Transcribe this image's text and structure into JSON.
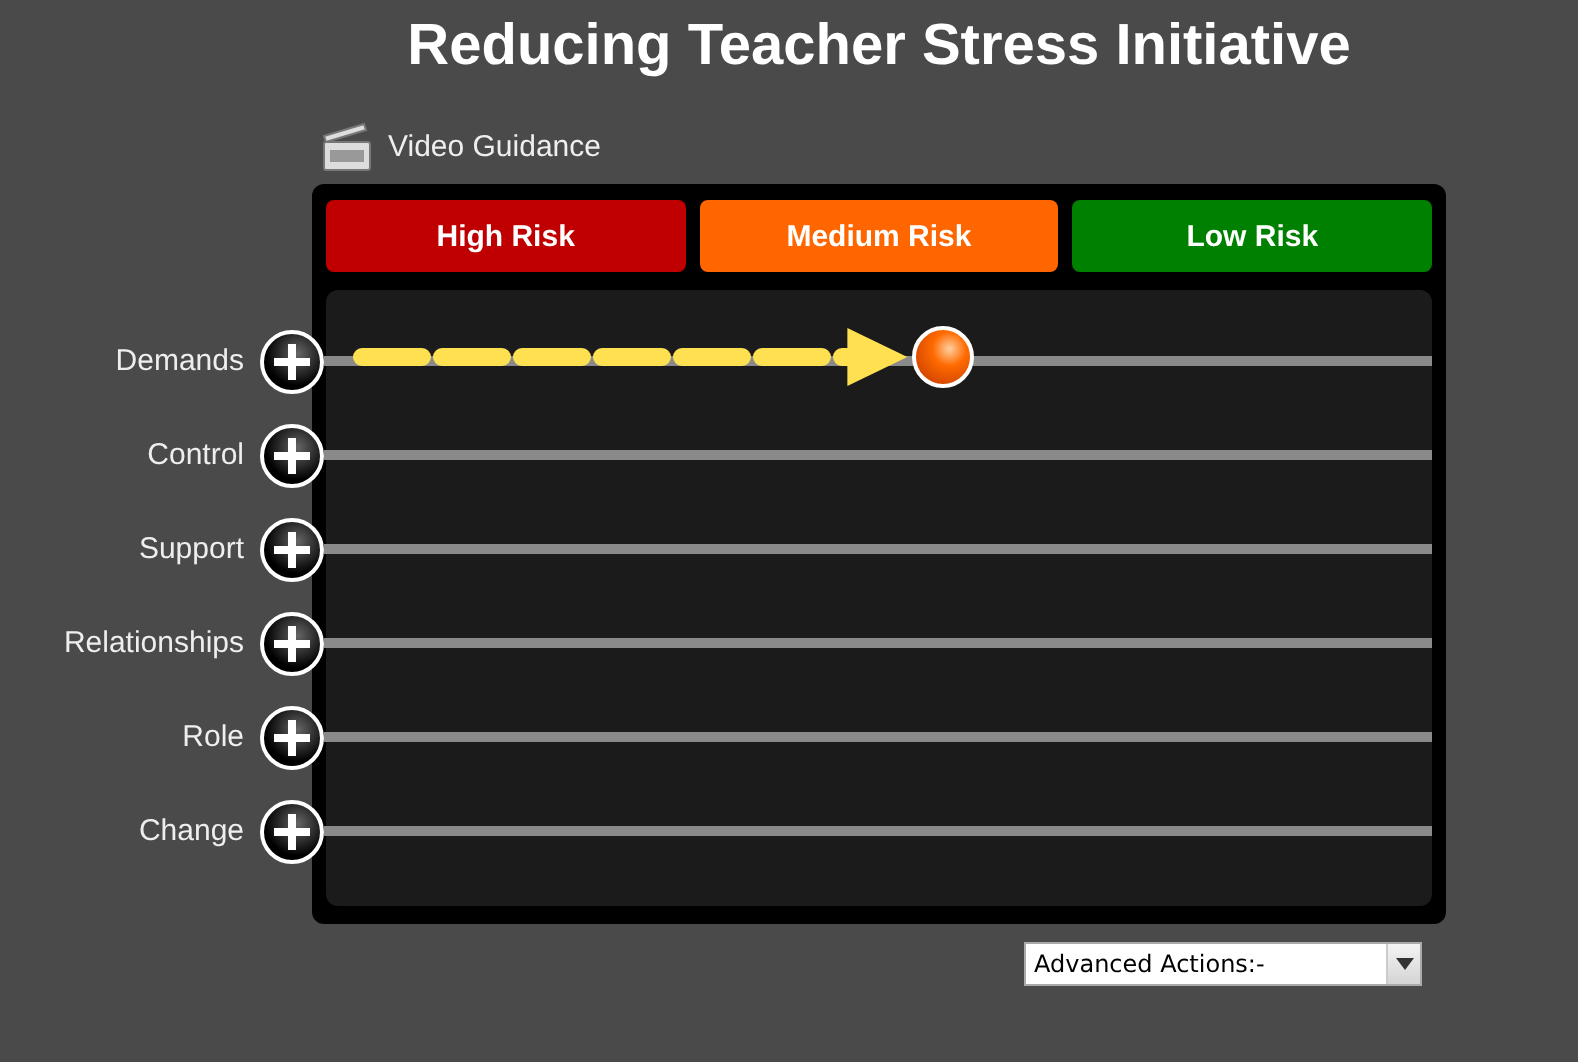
{
  "title": "Reducing Teacher Stress Initiative",
  "video_link": "Video Guidance",
  "risk_bands": [
    {
      "label": "High Risk",
      "color": "#c00000"
    },
    {
      "label": "Medium Risk",
      "color": "#ff6600"
    },
    {
      "label": "Low Risk",
      "color": "#008000"
    }
  ],
  "rows": [
    {
      "label": "Demands",
      "level": 0.56
    },
    {
      "label": "Control"
    },
    {
      "label": "Support"
    },
    {
      "label": "Relationships"
    },
    {
      "label": "Role"
    },
    {
      "label": "Change"
    }
  ],
  "actions_select": {
    "value": "Advanced Actions:-"
  }
}
